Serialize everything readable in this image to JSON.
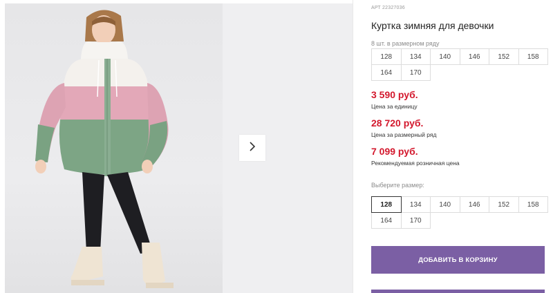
{
  "product": {
    "article": "АРТ 22327036",
    "title": "Куртка зимняя для девочки",
    "pack_caption": "8 шт. в размерном ряду",
    "pack_sizes": [
      "128",
      "134",
      "140",
      "146",
      "152",
      "158",
      "164",
      "170"
    ],
    "prices": [
      {
        "value": "3 590 руб.",
        "label": "Цена за единицу"
      },
      {
        "value": "28 720 руб.",
        "label": "Цена за размерный ряд"
      },
      {
        "value": "7 099 руб.",
        "label": "Рекомендуемая розничная цена"
      }
    ],
    "choose_size_caption": "Выберите размер:",
    "choose_sizes": [
      "128",
      "134",
      "140",
      "146",
      "152",
      "158",
      "164",
      "170"
    ],
    "selected_size": "128",
    "add_to_cart_label": "ДОБАВИТЬ В КОРЗИНУ"
  },
  "colors": {
    "accent": "#7b5fa4",
    "price": "#d3182d"
  },
  "icons": {
    "next": "chevron-right-icon"
  }
}
